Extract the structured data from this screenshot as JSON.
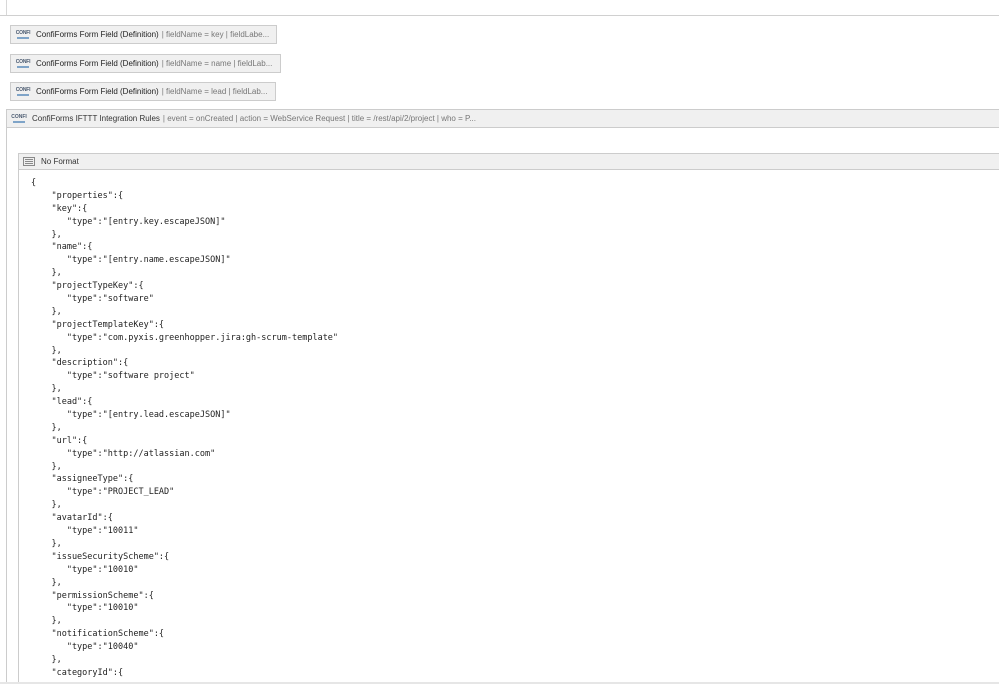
{
  "macros": [
    {
      "name": "ConfiForms Form Field (Definition)",
      "params": "| fieldName = key | fieldLabe..."
    },
    {
      "name": "ConfiForms Form Field (Definition)",
      "params": "| fieldName = name | fieldLab..."
    },
    {
      "name": "ConfiForms Form Field (Definition)",
      "params": "| fieldName = lead | fieldLab..."
    }
  ],
  "logo_text": "CONFI",
  "ifttt": {
    "name": "ConfiForms IFTTT Integration Rules",
    "params": "| event = onCreated | action = WebService Request | title = /rest/api/2/project | who = P..."
  },
  "noformat": {
    "label": "No Format"
  },
  "code_lines": [
    "{",
    "    \"properties\":{",
    "    \"key\":{",
    "       \"type\":\"[entry.key.escapeJSON]\"",
    "    },",
    "    \"name\":{",
    "       \"type\":\"[entry.name.escapeJSON]\"",
    "    },",
    "    \"projectTypeKey\":{",
    "       \"type\":\"software\"",
    "    },",
    "    \"projectTemplateKey\":{",
    "       \"type\":\"com.pyxis.greenhopper.jira:gh-scrum-template\"",
    "    },",
    "    \"description\":{",
    "       \"type\":\"software project\"",
    "    },",
    "    \"lead\":{",
    "       \"type\":\"[entry.lead.escapeJSON]\"",
    "    },",
    "    \"url\":{",
    "       \"type\":\"http://atlassian.com\"",
    "    },",
    "    \"assigneeType\":{",
    "       \"type\":\"PROJECT_LEAD\"",
    "    },",
    "    \"avatarId\":{",
    "       \"type\":\"10011\"",
    "    },",
    "    \"issueSecurityScheme\":{",
    "       \"type\":\"10010\"",
    "    },",
    "    \"permissionScheme\":{",
    "       \"type\":\"10010\"",
    "    },",
    "    \"notificationScheme\":{",
    "       \"type\":\"10040\"",
    "    },",
    "    \"categoryId\":{"
  ]
}
